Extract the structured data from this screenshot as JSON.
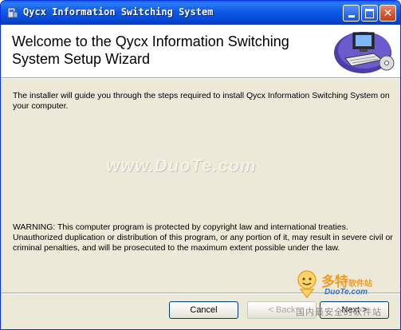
{
  "window": {
    "title": "Qycx Information Switching System"
  },
  "header": {
    "title": "Welcome to the Qycx Information Switching System Setup Wizard"
  },
  "body": {
    "intro": "The installer will guide you through the steps required to install Qycx Information Switching System on your computer.",
    "warning": "WARNING: This computer program is protected by copyright law and international treaties. Unauthorized duplication or distribution of this program, or any portion of it, may result in severe civil or criminal penalties, and will be prosecuted to the maximum extent possible under the law."
  },
  "watermark": {
    "text": "www.DuoTe.com"
  },
  "footer": {
    "cancel_label": "Cancel",
    "back_label": "< Back",
    "next_label": "Next >"
  },
  "logo": {
    "cn": "多特",
    "cn_sub": "软件站",
    "en": "DuoTe.com",
    "overlay": "国内最安全的软件站"
  },
  "icons": {
    "app": "installer-icon",
    "header": "computer-with-disc-icon"
  },
  "colors": {
    "titlebar": "#0a5cf2",
    "window_bg": "#ece9d8",
    "header_bg": "#ffffff"
  }
}
